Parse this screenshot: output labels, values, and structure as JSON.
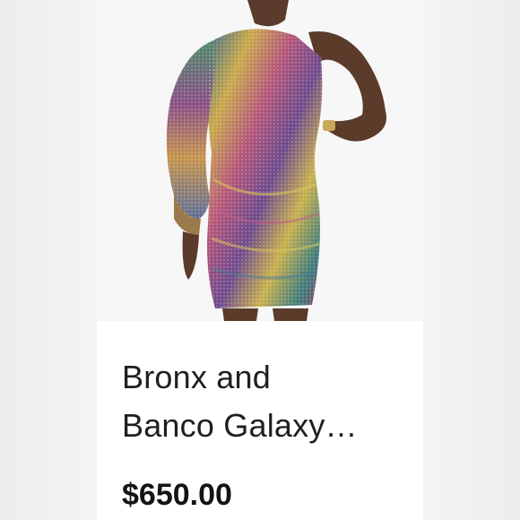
{
  "product": {
    "image_alt": "Sequined one-shoulder mini dress worn by model",
    "title_line1": "Bronx and",
    "title_line2": "Banco Galaxy…",
    "price": "$650.00"
  },
  "colors": {
    "card_background": "#ffffff",
    "page_background": "#ececec",
    "text_primary": "#1f1f1f"
  }
}
